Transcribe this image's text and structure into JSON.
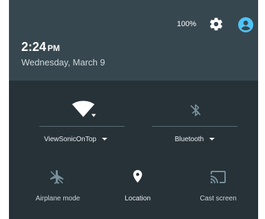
{
  "status": {
    "battery": "100%",
    "settings_icon": "gear-icon",
    "account_icon": "account-icon"
  },
  "header": {
    "time": "2:24",
    "ampm": "PM",
    "date": "Wednesday, March 9"
  },
  "tiles": {
    "wifi": {
      "label": "ViewSonicOnTop",
      "icon": "wifi-icon"
    },
    "bluetooth": {
      "label": "Bluetooth",
      "icon": "bluetooth-off-icon"
    },
    "airplane": {
      "label": "Airplane mode",
      "icon": "airplane-icon"
    },
    "location": {
      "label": "Location",
      "icon": "location-pin-icon"
    },
    "cast": {
      "label": "Cast screen",
      "icon": "cast-icon"
    }
  },
  "colors": {
    "panel_bg": "#263238",
    "header_bg": "#37474f",
    "accent": "#4fc3f7"
  }
}
